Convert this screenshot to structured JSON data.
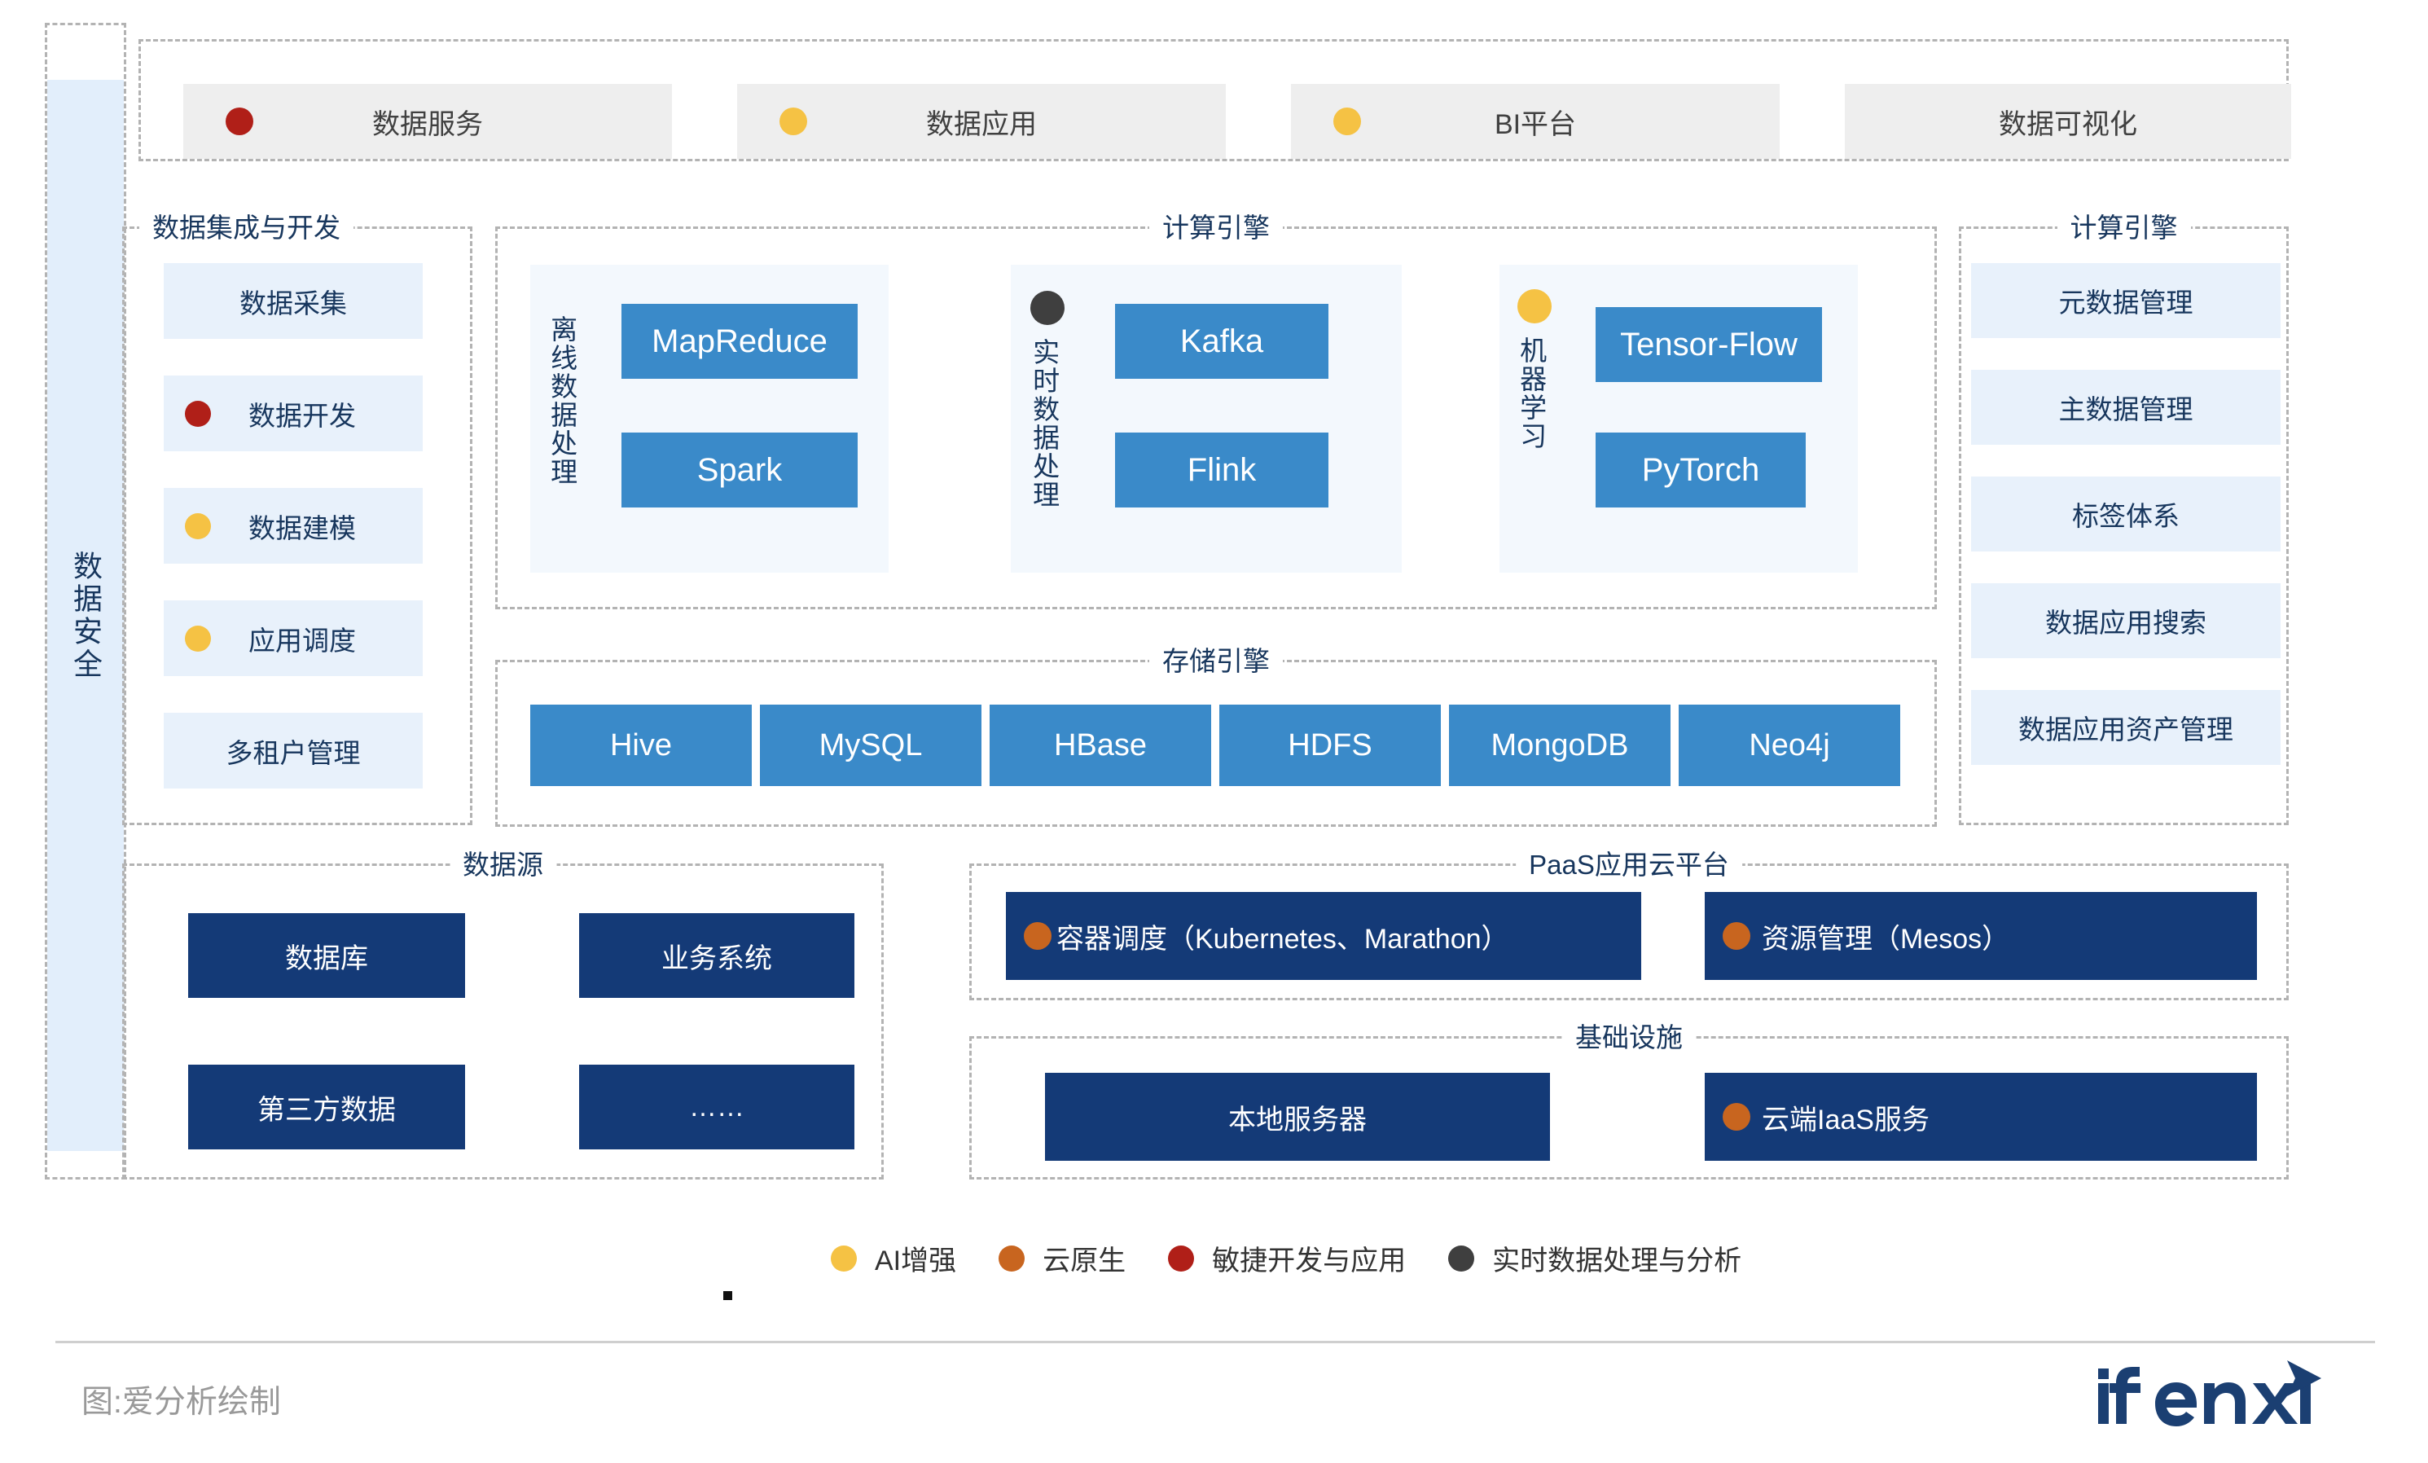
{
  "security_rail": {
    "label": "数据安全"
  },
  "top_services": {
    "items": [
      {
        "label": "数据服务",
        "dot": "#b01f18",
        "has_dot": true
      },
      {
        "label": "数据应用",
        "dot": "#f5c244",
        "has_dot": true
      },
      {
        "label": "BI平台",
        "dot": "#f5c244",
        "has_dot": true
      },
      {
        "label": "数据可视化",
        "dot": "",
        "has_dot": false
      }
    ]
  },
  "integration": {
    "title": "数据集成与开发",
    "items": [
      {
        "label": "数据采集",
        "dot": "",
        "has_dot": false
      },
      {
        "label": "数据开发",
        "dot": "#b01f18",
        "has_dot": true
      },
      {
        "label": "数据建模",
        "dot": "#f5c244",
        "has_dot": true
      },
      {
        "label": "应用调度",
        "dot": "#f5c244",
        "has_dot": true
      },
      {
        "label": "多租户管理",
        "dot": "",
        "has_dot": false
      }
    ]
  },
  "compute": {
    "title": "计算引擎",
    "groups": [
      {
        "label": "离线数据处理",
        "dot": "",
        "has_dot": false,
        "tiles": [
          "MapReduce",
          "Spark"
        ]
      },
      {
        "label": "实时数据处理",
        "dot": "#3f3f3f",
        "has_dot": true,
        "tiles": [
          "Kafka",
          "Flink"
        ]
      },
      {
        "label": "机器学习",
        "dot": "#f5c244",
        "has_dot": true,
        "tiles": [
          "Tensor-Flow",
          "PyTorch"
        ]
      }
    ]
  },
  "storage": {
    "title": "存储引擎",
    "tiles": [
      "Hive",
      "MySQL",
      "HBase",
      "HDFS",
      "MongoDB",
      "Neo4j"
    ]
  },
  "governance": {
    "title": "计算引擎",
    "items": [
      "元数据管理",
      "主数据管理",
      "标签体系",
      "数据应用搜索",
      "数据应用资产管理"
    ]
  },
  "data_source": {
    "title": "数据源",
    "tiles": [
      "数据库",
      "业务系统",
      "第三方数据",
      "……"
    ]
  },
  "paas": {
    "title": "PaaS应用云平台",
    "tiles": [
      {
        "label": "容器调度（Kubernetes、Marathon）",
        "dot": "#c8651f",
        "has_dot": true
      },
      {
        "label": "资源管理（Mesos）",
        "dot": "#c8651f",
        "has_dot": true
      }
    ]
  },
  "infrastructure": {
    "title": "基础设施",
    "tiles": [
      {
        "label": "本地服务器",
        "dot": "",
        "has_dot": false
      },
      {
        "label": "云端IaaS服务",
        "dot": "#c8651f",
        "has_dot": true
      }
    ]
  },
  "legend": {
    "items": [
      {
        "label": "AI增强",
        "color": "#f5c244"
      },
      {
        "label": "云原生",
        "color": "#c8651f"
      },
      {
        "label": "敏捷开发与应用",
        "color": "#b01f18"
      },
      {
        "label": "实时数据处理与分析",
        "color": "#3f3f3f"
      }
    ]
  },
  "footer": {
    "credit": "图:爱分析绘制",
    "logo_text": "ifenxi"
  },
  "colors": {
    "tile_blue": "#3a8ac9",
    "deep_blue": "#143a77",
    "text_blue": "#17365d",
    "panel_blue": "#e8f1fb",
    "panel_grey": "#eeeeee"
  }
}
